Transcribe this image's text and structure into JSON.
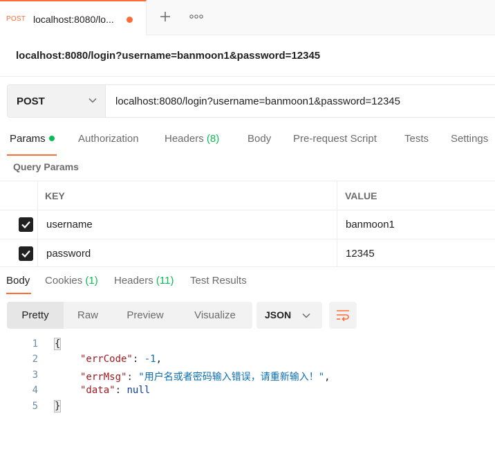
{
  "tab": {
    "method": "POST",
    "title": "localhost:8080/lo...",
    "dot_color": "#ff6c37",
    "add_icon": "plus-icon",
    "more_icon": "more-horizontal-icon"
  },
  "request": {
    "title": "localhost:8080/login?username=banmoon1&password=12345",
    "method": "POST",
    "method_icon": "chevron-down-icon",
    "url": "localhost:8080/login?username=banmoon1&password=12345",
    "tabs": {
      "params": "Params",
      "authorization": "Authorization",
      "headers": "Headers",
      "headers_count": "(8)",
      "body": "Body",
      "prerequest": "Pre-request Script",
      "tests": "Tests",
      "settings": "Settings"
    }
  },
  "query_params": {
    "label": "Query Params",
    "headers": {
      "key": "KEY",
      "value": "VALUE"
    },
    "rows": [
      {
        "checked": true,
        "key": "username",
        "value": "banmoon1"
      },
      {
        "checked": true,
        "key": "password",
        "value": "12345"
      }
    ]
  },
  "response": {
    "tabs": {
      "body": "Body",
      "cookies": "Cookies",
      "cookies_count": "(1)",
      "headers": "Headers",
      "headers_count": "(11)",
      "test_results": "Test Results"
    },
    "views": {
      "pretty": "Pretty",
      "raw": "Raw",
      "preview": "Preview",
      "visualize": "Visualize"
    },
    "format": "JSON",
    "wrap_icon": "wrap-lines-icon",
    "code": {
      "line_numbers": [
        "1",
        "2",
        "3",
        "4",
        "5"
      ],
      "open_brace": "{",
      "close_brace": "}",
      "errCode_key": "\"errCode\"",
      "errCode_value": "-1",
      "errMsg_key": "\"errMsg\"",
      "errMsg_value": "\"用户名或者密码输入错误，请重新输入！\"",
      "data_key": "\"data\"",
      "data_value": "null",
      "colon": ": ",
      "comma": ","
    }
  },
  "colors": {
    "accent": "#ff6c37",
    "success": "#0cbb52",
    "json_key": "#a3191f",
    "json_value": "#0a6fb3"
  }
}
